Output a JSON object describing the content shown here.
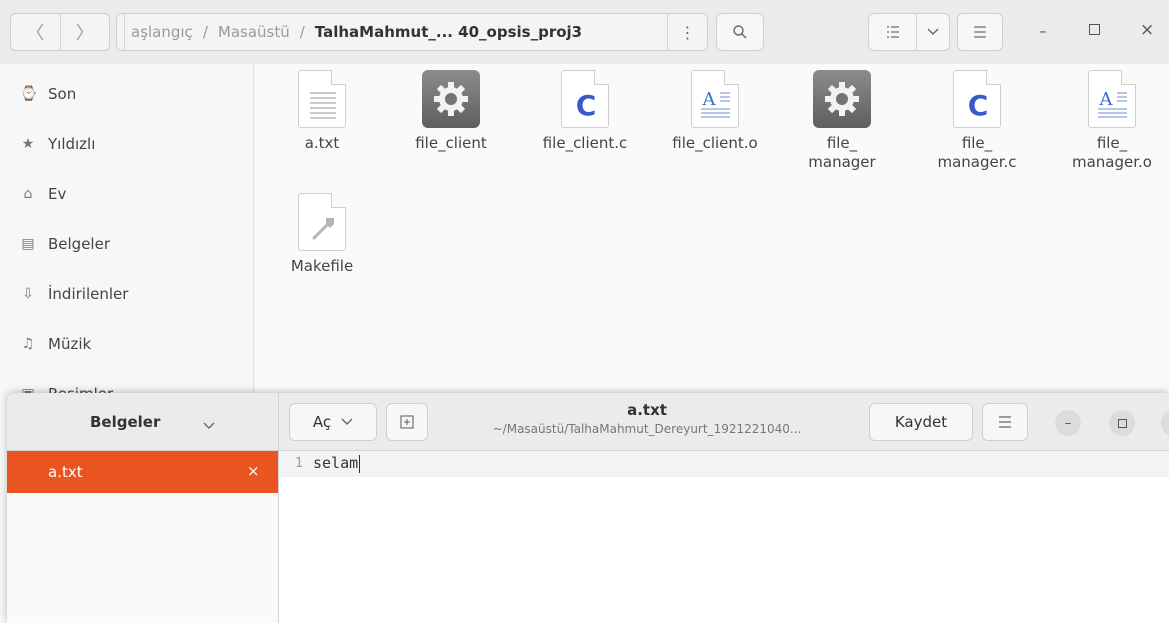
{
  "file_manager": {
    "breadcrumbs": [
      "aşlangıç",
      "Masaüstü"
    ],
    "current_folder": "TalhaMahmut_... 40_opsis_proj3",
    "sidebar": [
      {
        "label": "Son",
        "icon": "clock-icon"
      },
      {
        "label": "Yıldızlı",
        "icon": "star-icon"
      },
      {
        "label": "Ev",
        "icon": "home-icon"
      },
      {
        "label": "Belgeler",
        "icon": "document-icon"
      },
      {
        "label": "İndirilenler",
        "icon": "download-icon"
      },
      {
        "label": "Müzik",
        "icon": "music-icon"
      },
      {
        "label": "Resimler",
        "icon": "picture-icon"
      }
    ],
    "files": [
      {
        "name": "a.txt",
        "icon": "text-file-icon"
      },
      {
        "name": "file_client",
        "icon": "executable-icon"
      },
      {
        "name": "file_client.c",
        "icon": "c-source-icon"
      },
      {
        "name": "file_client.o",
        "icon": "object-file-icon"
      },
      {
        "name": "file_\nmanager",
        "icon": "executable-icon"
      },
      {
        "name": "file_\nmanager.c",
        "icon": "c-source-icon"
      },
      {
        "name": "file_\nmanager.o",
        "icon": "object-file-icon"
      },
      {
        "name": "Makefile",
        "icon": "makefile-icon"
      }
    ]
  },
  "editor": {
    "sidebar_title": "Belgeler",
    "open_label": "Aç",
    "title": "a.txt",
    "subtitle": "~/Masaüstü/TalhaMahmut_Dereyurt_1921221040...",
    "save_label": "Kaydet",
    "tab_label": "a.txt",
    "line_number": "1",
    "line_text": "selam",
    "accent": "#e95420"
  }
}
